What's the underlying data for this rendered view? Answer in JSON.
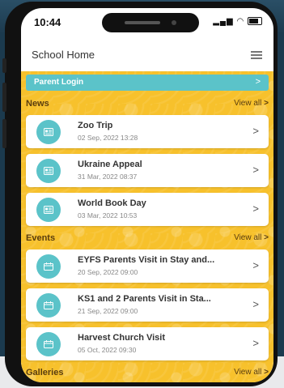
{
  "status_bar": {
    "time": "10:44"
  },
  "app_bar": {
    "title": "School Home"
  },
  "parent_login": {
    "label": "Parent Login"
  },
  "news": {
    "title": "News",
    "view_all": "View all",
    "items": [
      {
        "title": "Zoo Trip",
        "date": "02 Sep, 2022 13:28"
      },
      {
        "title": "Ukraine Appeal",
        "date": "31 Mar, 2022 08:37"
      },
      {
        "title": "World Book Day",
        "date": "03 Mar, 2022 10:53"
      }
    ]
  },
  "events": {
    "title": "Events",
    "view_all": "View all",
    "items": [
      {
        "title": "EYFS Parents Visit in Stay and...",
        "date": "20 Sep, 2022 09:00"
      },
      {
        "title": "KS1 and 2 Parents Visit in Sta...",
        "date": "21 Sep, 2022 09:00"
      },
      {
        "title": "Harvest Church Visit",
        "date": "05 Oct, 2022 09:30"
      }
    ]
  },
  "galleries": {
    "title": "Galleries",
    "view_all": "View all"
  },
  "colors": {
    "accent": "#5bc3c9",
    "background": "#f7c12c"
  },
  "icons": {
    "news": "newspaper-icon",
    "events": "calendar-icon",
    "chevron": "chevron-right-icon",
    "menu": "hamburger-menu-icon"
  }
}
